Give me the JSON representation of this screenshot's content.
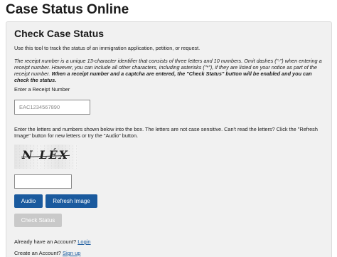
{
  "page": {
    "title": "Case Status Online"
  },
  "card": {
    "title": "Check Case Status",
    "intro": "Use this tool to track the status of an immigration application, petition, or request.",
    "receipt_info_italic": "The receipt number is a unique 13-character identifier that consists of three letters and 10 numbers. Omit dashes (\"-\") when entering a receipt number. However, you can include all other characters, including asterisks (\"*\"), if they are listed on your notice as part of the receipt number.",
    "receipt_info_bold": "When a receipt number and a captcha are entered, the \"Check Status\" button will be enabled and you can check the status.",
    "receipt_label": "Enter a Receipt Number",
    "receipt_placeholder": "EAC1234567890",
    "captcha_info": "Enter the letters and numbers shown below into the box. The letters are not case sensitive. Can't read the letters? Click the \"Refresh Image\" button for new letters or try the \"Audio\" button.",
    "captcha_code": "N LÉX",
    "captcha_value": "",
    "buttons": {
      "audio": "Audio",
      "refresh": "Refresh Image",
      "check_status": "Check Status"
    },
    "account": {
      "login_prompt": "Already have an Account?",
      "login_link": "Login",
      "signup_prompt": "Create an Account?",
      "signup_link": "Sign up"
    }
  },
  "colors": {
    "primary_button": "#1a5a9e",
    "disabled_button": "#c9c9c9",
    "card_background": "#f1f1f1",
    "link": "#1a5a9e"
  }
}
